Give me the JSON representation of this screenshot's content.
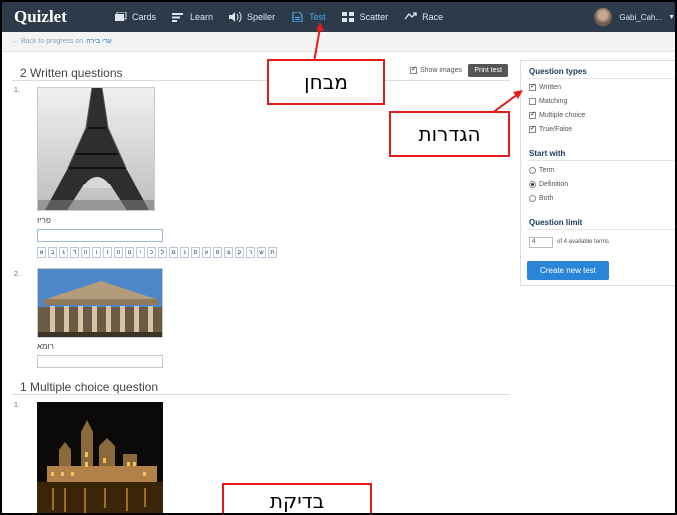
{
  "nav": {
    "logo": "Quizlet",
    "items": [
      {
        "label": "Cards",
        "icon": "cards-icon",
        "active": false
      },
      {
        "label": "Learn",
        "icon": "learn-icon",
        "active": false
      },
      {
        "label": "Speller",
        "icon": "speaker-icon",
        "active": false
      },
      {
        "label": "Test",
        "icon": "document-icon",
        "active": true
      },
      {
        "label": "Scatter",
        "icon": "scatter-icon",
        "active": false
      },
      {
        "label": "Race",
        "icon": "race-icon",
        "active": false
      }
    ],
    "username": "Gabi_Cah..."
  },
  "breadcrumb": {
    "prefix": "← Back to progress on",
    "link": "ערי בירה"
  },
  "written_section": {
    "title": "2 Written questions",
    "show_images_label": "Show images",
    "print_label": "Print test",
    "questions": [
      {
        "number": "1.",
        "image": "eiffel-tower-photo",
        "label": "פריז"
      },
      {
        "number": "2.",
        "image": "pantheon-photo",
        "label": "רומא"
      }
    ],
    "keyboard": [
      "א",
      "ב",
      "ג",
      "ד",
      "ה",
      "ו",
      "ז",
      "ח",
      "ט",
      "י",
      "כ",
      "ל",
      "מ",
      "נ",
      "ס",
      "ע",
      "פ",
      "צ",
      "ק",
      "ר",
      "ש",
      "ת"
    ]
  },
  "mc_section": {
    "title": "1 Multiple choice question",
    "questions": [
      {
        "number": "1.",
        "image": "night-city-photo"
      }
    ]
  },
  "sidebar": {
    "question_types_heading": "Question types",
    "question_types": [
      {
        "label": "Written",
        "checked": true
      },
      {
        "label": "Matching",
        "checked": false
      },
      {
        "label": "Multiple choice",
        "checked": true
      },
      {
        "label": "True/False",
        "checked": true
      }
    ],
    "start_with_heading": "Start with",
    "start_with": [
      {
        "label": "Term",
        "selected": false
      },
      {
        "label": "Definition",
        "selected": true
      },
      {
        "label": "Both",
        "selected": false
      }
    ],
    "question_limit_heading": "Question limit",
    "question_limit_value": "4",
    "question_limit_suffix": "of 4 available terms",
    "create_label": "Create new test"
  },
  "annotations": {
    "test_callout": "מבחן",
    "settings_callout": "הגדרות",
    "check_callout": "בדיקת",
    "color": "#e41b1b"
  }
}
